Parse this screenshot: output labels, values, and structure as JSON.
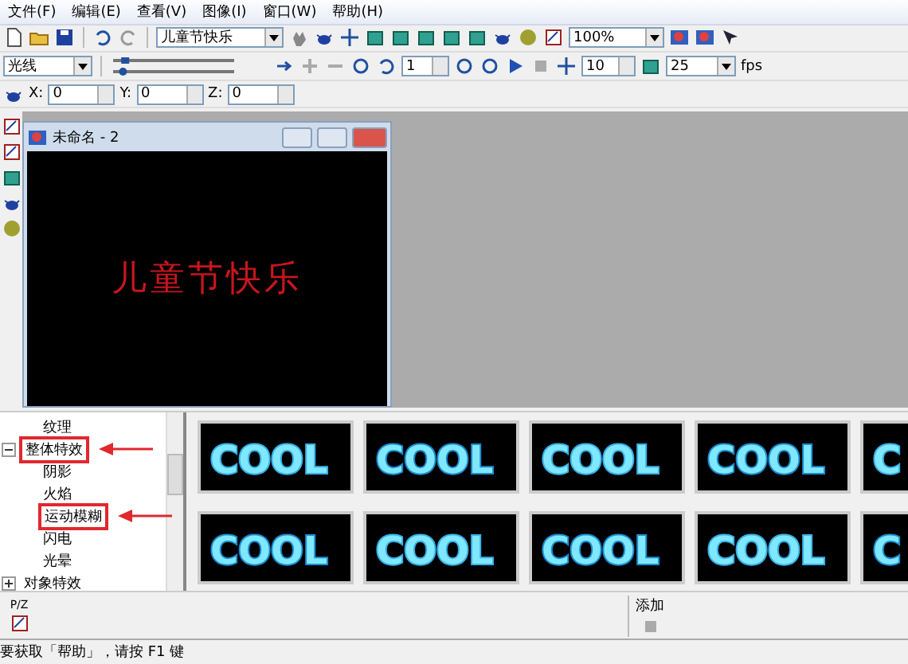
{
  "menu": [
    "文件(F)",
    "编辑(E)",
    "查看(V)",
    "图像(I)",
    "窗口(W)",
    "帮助(H)"
  ],
  "toolbar1": {
    "text_combo": "儿童节快乐",
    "zoom_combo": "100%"
  },
  "toolbar2": {
    "object_combo": "光线",
    "key_slider": {
      "level": 0.08
    },
    "frame_slider": {
      "level": 0.06
    },
    "frame_spin": "1",
    "step_spin": "10",
    "rate_combo": "25",
    "rate_unit": "fps"
  },
  "toolbar3": {
    "coords": [
      {
        "label": "X:",
        "value": "0"
      },
      {
        "label": "Y:",
        "value": "0"
      },
      {
        "label": "Z:",
        "value": "0"
      }
    ]
  },
  "document_window": {
    "title": "未命名 - 2",
    "content_text": "儿童节快乐"
  },
  "effects_tree": [
    {
      "label": "纹理"
    },
    {
      "label": "整体特效",
      "expanded": true,
      "highlighted": true,
      "children": [
        {
          "label": "阴影",
          "highlighted": false
        },
        {
          "label": "火焰",
          "highlighted": false
        },
        {
          "label": "运动模糊",
          "highlighted": true
        },
        {
          "label": "闪电",
          "highlighted": false
        },
        {
          "label": "光晕",
          "highlighted": false
        }
      ]
    },
    {
      "label": "对象特效",
      "expanded": false,
      "highlighted": false
    }
  ],
  "thumbnails": [
    {
      "text": "COOL"
    },
    {
      "text": "COOL"
    },
    {
      "text": "COOL"
    },
    {
      "text": "COOL"
    },
    {
      "text": "C"
    },
    {
      "text": "COOL"
    },
    {
      "text": "COOL"
    },
    {
      "text": "COOL"
    },
    {
      "text": "COOL"
    },
    {
      "text": "C"
    }
  ],
  "pz_label": "P/Z",
  "add_label": "添加",
  "status_bar": "要获取「帮助」，请按 F1 键"
}
